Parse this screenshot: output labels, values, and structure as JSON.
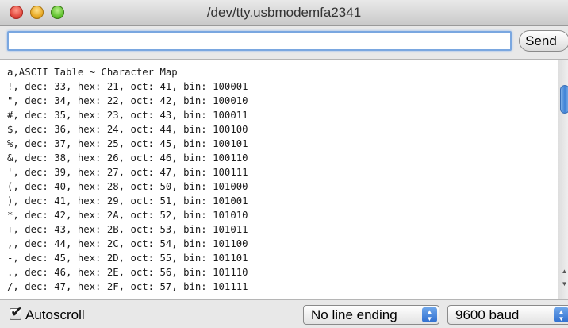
{
  "window": {
    "title": "/dev/tty.usbmodemfa2341"
  },
  "send": {
    "input_value": "",
    "button_label": "Send"
  },
  "output": {
    "lines": [
      "a,ASCII Table ~ Character Map",
      "!, dec: 33, hex: 21, oct: 41, bin: 100001",
      "\", dec: 34, hex: 22, oct: 42, bin: 100010",
      "#, dec: 35, hex: 23, oct: 43, bin: 100011",
      "$, dec: 36, hex: 24, oct: 44, bin: 100100",
      "%, dec: 37, hex: 25, oct: 45, bin: 100101",
      "&, dec: 38, hex: 26, oct: 46, bin: 100110",
      "', dec: 39, hex: 27, oct: 47, bin: 100111",
      "(, dec: 40, hex: 28, oct: 50, bin: 101000",
      "), dec: 41, hex: 29, oct: 51, bin: 101001",
      "*, dec: 42, hex: 2A, oct: 52, bin: 101010",
      "+, dec: 43, hex: 2B, oct: 53, bin: 101011",
      ",, dec: 44, hex: 2C, oct: 54, bin: 101100",
      "-, dec: 45, hex: 2D, oct: 55, bin: 101101",
      "., dec: 46, hex: 2E, oct: 56, bin: 101110",
      "/, dec: 47, hex: 2F, oct: 57, bin: 101111"
    ]
  },
  "bottom": {
    "autoscroll_label": "Autoscroll",
    "autoscroll_checked": true,
    "line_ending_selected": "No line ending",
    "baud_selected": "9600 baud"
  },
  "icons": {
    "close": "close-button",
    "minimize": "minimize-button",
    "maximize": "zoom-button",
    "select_arrows": "up-down-arrows-icon",
    "checkmark": "checkmark-icon"
  },
  "colors": {
    "focus_ring": "#7aa7e0",
    "scroll_thumb": "#3f82d6",
    "select_arrow_bg": "#2f6fd0"
  }
}
